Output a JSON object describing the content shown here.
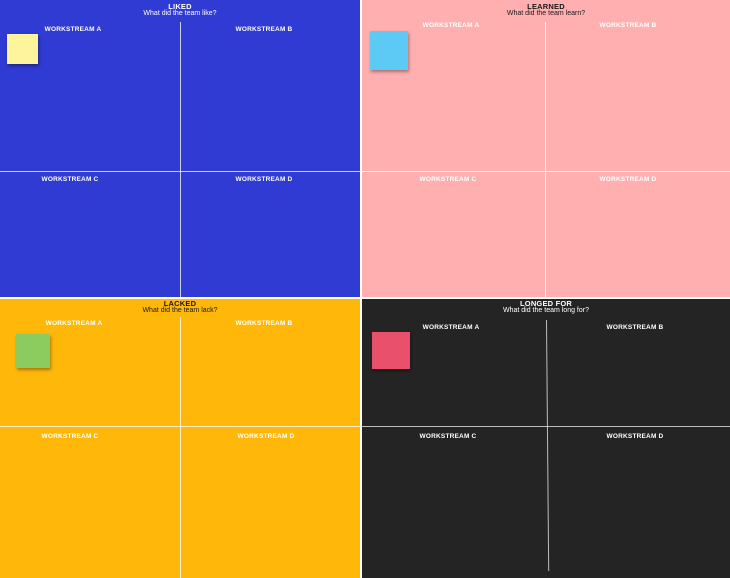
{
  "board": {
    "liked": {
      "title": "LIKED",
      "subtitle": "What did the team like?",
      "bg": "#2f3bd3",
      "text_color": "#ffffff",
      "workstreams": [
        "WORKSTREAM A",
        "WORKSTREAM B",
        "WORKSTREAM C",
        "WORKSTREAM D"
      ],
      "sticky_color": "#fdf49c"
    },
    "learned": {
      "title": "LEARNED",
      "subtitle": "What did the team learn?",
      "bg": "#ffafaf",
      "text_color": "#ffffff",
      "workstreams": [
        "WORKSTREAM A",
        "WORKSTREAM B",
        "WORKSTREAM C",
        "WORKSTREAM D"
      ],
      "sticky_color": "#5ccaf4"
    },
    "lacked": {
      "title": "LACKED",
      "subtitle": "What did the team lack?",
      "bg": "#ffb70a",
      "text_color": "#ffffff",
      "workstreams": [
        "WORKSTREAM A",
        "WORKSTREAM B",
        "WORKSTREAM C",
        "WORKSTREAM D"
      ],
      "sticky_color": "#8ccb5e"
    },
    "longed_for": {
      "title": "LONGED FOR",
      "subtitle": "What did the team long for?",
      "bg": "#242424",
      "text_color": "#ffffff",
      "workstreams": [
        "WORKSTREAM A",
        "WORKSTREAM B",
        "WORKSTREAM C",
        "WORKSTREAM D"
      ],
      "sticky_color": "#e9506b"
    }
  }
}
